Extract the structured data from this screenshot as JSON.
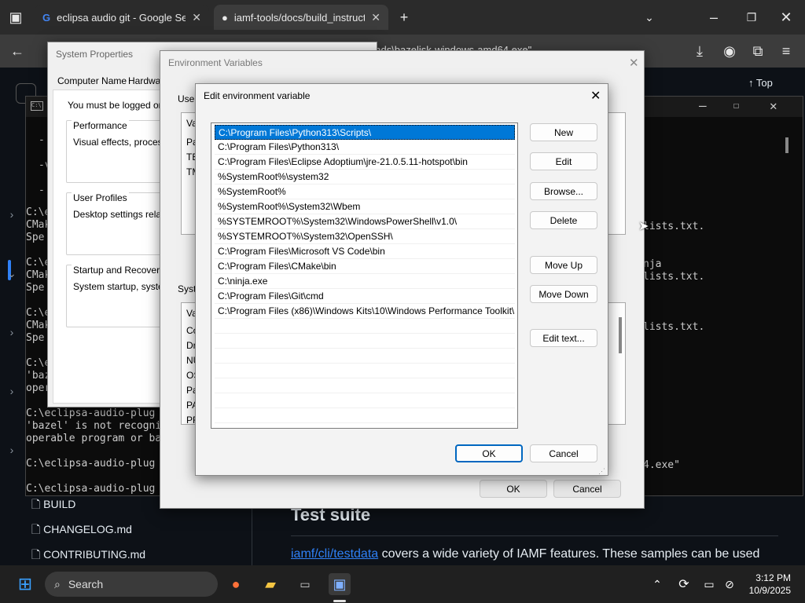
{
  "browser": {
    "tabs": [
      {
        "label": "eclipsa audio git - Google Search",
        "icon": "google-icon"
      },
      {
        "label": "iamf-tools/docs/build_instructions",
        "icon": "github-icon"
      }
    ],
    "address_fragment": "oads\\bazelisk-windows-amd64.exe\"",
    "top_label": "Top"
  },
  "terminal": {
    "lines": [
      "-",
      "-v",
      "-",
      "C:\\e",
      "CMak",
      "Spe",
      "C:\\e",
      "CMak",
      "Spe",
      "C:\\e",
      "CMak",
      "Spe",
      "C:\\e",
      "'baz",
      "oper",
      "C:\\eclipsa-audio-plug",
      "'bazel' is not recogni",
      "operable program or ba",
      "C:\\eclipsa-audio-plug",
      "C:\\eclipsa-audio-plug"
    ],
    "right_text": [
      "lists.txt.",
      "nja",
      "lists.txt.",
      "lists.txt.",
      "4.exe\""
    ]
  },
  "github": {
    "files": [
      "BUILD",
      "CHANGELOG.md",
      "CONTRIBUTING.md"
    ],
    "heading": "Test suite",
    "link": "iamf/cli/testdata",
    "paragraph": " covers a wide variety of IAMF features. These samples can be used"
  },
  "system_properties": {
    "title": "System Properties",
    "tabs": [
      "Computer Name",
      "Hardware"
    ],
    "note": "You must be logged on a",
    "groups": [
      {
        "title": "Performance",
        "text": "Visual effects, processo"
      },
      {
        "title": "User Profiles",
        "text": "Desktop settings related"
      },
      {
        "title": "Startup and Recovery",
        "text": "System startup, system f"
      }
    ]
  },
  "env_vars": {
    "title": "Environment Variables",
    "user_label": "User",
    "user_col": "Va",
    "user_rows": [
      "Pa",
      "TE",
      "TM"
    ],
    "system_label": "Syste",
    "system_col": "Va",
    "system_rows": [
      "Co",
      "Dr",
      "NU",
      "OS",
      "Pa",
      "PA",
      "PR"
    ],
    "ok": "OK",
    "cancel": "Cancel"
  },
  "edit_dialog": {
    "title": "Edit environment variable",
    "entries": [
      "C:\\Program Files\\Python313\\Scripts\\",
      "C:\\Program Files\\Python313\\",
      "C:\\Program Files\\Eclipse Adoptium\\jre-21.0.5.11-hotspot\\bin",
      "%SystemRoot%\\system32",
      "%SystemRoot%",
      "%SystemRoot%\\System32\\Wbem",
      "%SYSTEMROOT%\\System32\\WindowsPowerShell\\v1.0\\",
      "%SYSTEMROOT%\\System32\\OpenSSH\\",
      "C:\\Program Files\\Microsoft VS Code\\bin",
      "C:\\Program Files\\CMake\\bin",
      "C:\\ninja.exe",
      "C:\\Program Files\\Git\\cmd",
      "C:\\Program Files (x86)\\Windows Kits\\10\\Windows Performance Toolkit\\"
    ],
    "selected_index": 0,
    "buttons": {
      "new": "New",
      "edit": "Edit",
      "browse": "Browse...",
      "delete": "Delete",
      "move_up": "Move Up",
      "move_down": "Move Down",
      "edit_text": "Edit text...",
      "ok": "OK",
      "cancel": "Cancel"
    }
  },
  "taskbar": {
    "search": "Search",
    "time": "3:12 PM",
    "date": "10/9/2025"
  }
}
